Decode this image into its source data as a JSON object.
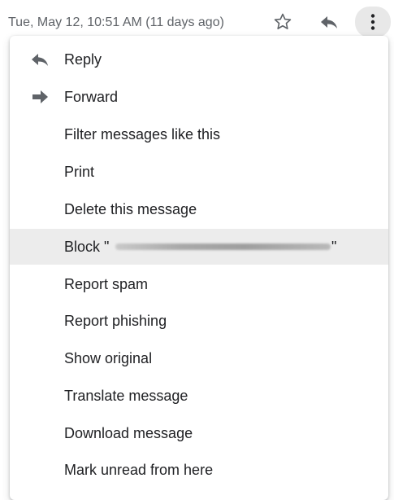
{
  "header": {
    "date": "Tue, May 12, 10:51 AM (11 days ago)",
    "icons": {
      "star": "star-outline-icon",
      "reply": "reply-icon",
      "more": "more-vert-icon"
    }
  },
  "menu": {
    "items": [
      {
        "label": "Reply",
        "icon": "reply-icon"
      },
      {
        "label": "Forward",
        "icon": "forward-icon"
      },
      {
        "label": "Filter messages like this"
      },
      {
        "label": "Print"
      },
      {
        "label": "Delete this message"
      },
      {
        "label": "Block \"",
        "label_suffix": "\"",
        "highlighted": true
      },
      {
        "label": "Report spam"
      },
      {
        "label": "Report phishing"
      },
      {
        "label": "Show original"
      },
      {
        "label": "Translate message"
      },
      {
        "label": "Download message"
      },
      {
        "label": "Mark unread from here"
      }
    ]
  },
  "colors": {
    "text": "#202124",
    "secondary_text": "#5f6368",
    "icon": "#5f6368",
    "highlight": "#ececec"
  }
}
